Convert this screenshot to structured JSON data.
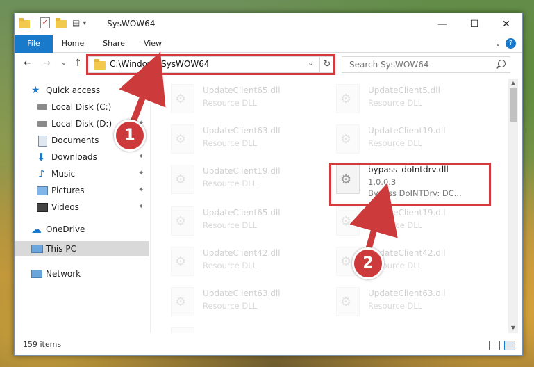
{
  "window": {
    "title": "SysWOW64",
    "controls": {
      "minimize": "—",
      "maximize": "☐",
      "close": "✕"
    }
  },
  "ribbon": {
    "tabs": [
      "File",
      "Home",
      "Share",
      "View"
    ],
    "help": "?",
    "expand": "⌄"
  },
  "navigation": {
    "back": "←",
    "forward": "→",
    "recent": "⌄",
    "up": "↑",
    "address": "C:\\Windows\\SysWOW64",
    "address_dropdown": "⌄",
    "refresh": "↻",
    "search_placeholder": "Search SysWOW64"
  },
  "sidebar": {
    "items": [
      {
        "label": "Quick access",
        "icon": "star-icon",
        "pinned": false
      },
      {
        "label": "Local Disk (C:)",
        "icon": "drive-icon",
        "pinned": true
      },
      {
        "label": "Local Disk (D:)",
        "icon": "drive-icon",
        "pinned": true
      },
      {
        "label": "Documents",
        "icon": "documents-icon",
        "pinned": true
      },
      {
        "label": "Downloads",
        "icon": "download-icon",
        "pinned": true
      },
      {
        "label": "Music",
        "icon": "music-icon",
        "pinned": true
      },
      {
        "label": "Pictures",
        "icon": "pictures-icon",
        "pinned": true
      },
      {
        "label": "Videos",
        "icon": "videos-icon",
        "pinned": true
      },
      {
        "label": "OneDrive",
        "icon": "cloud-icon",
        "pinned": false
      },
      {
        "label": "This PC",
        "icon": "computer-icon",
        "pinned": false,
        "selected": true
      },
      {
        "label": "Network",
        "icon": "network-icon",
        "pinned": false
      }
    ],
    "pin_glyph": "📌"
  },
  "files": {
    "left": [
      {
        "name": "UpdateClient65.dll",
        "type": "Resource DLL"
      },
      {
        "name": "UpdateClient63.dll",
        "type": "Resource DLL"
      },
      {
        "name": "UpdateClient19.dll",
        "type": "Resource DLL"
      },
      {
        "name": "UpdateClient65.dll",
        "type": "Resource DLL"
      },
      {
        "name": "UpdateClient42.dll",
        "type": "Resource DLL"
      },
      {
        "name": "UpdateClient63.dll",
        "type": "Resource DLL"
      },
      {
        "name": "",
        "type": ""
      }
    ],
    "right": [
      {
        "name": "UpdateClient5.dll",
        "type": "Resource DLL"
      },
      {
        "name": "UpdateClient19.dll",
        "type": "Resource DLL"
      },
      {
        "name": "bypass_doIntdrv.dll",
        "version": "1.0.0.3",
        "description": "Bypass DoINTDrv: DC...",
        "highlighted": true
      },
      {
        "name": "UpdateClient19.dll",
        "type": "Resource DLL"
      },
      {
        "name": "UpdateClient42.dll",
        "type": "Resource DLL"
      },
      {
        "name": "UpdateClient63.dll",
        "type": "Resource DLL"
      }
    ]
  },
  "status": {
    "count": "159 items"
  },
  "annotations": {
    "callouts": [
      "1",
      "2"
    ],
    "color": "#d6393d"
  },
  "colors": {
    "file_tab": "#1979ca",
    "selection": "#d9d9d9"
  }
}
